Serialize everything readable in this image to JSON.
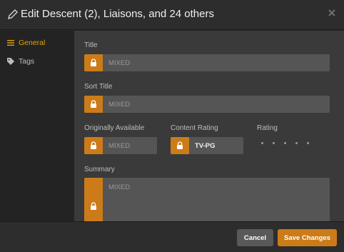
{
  "header": {
    "title": "Edit Descent (2), Liaisons, and 24 others"
  },
  "sidebar": {
    "items": [
      {
        "label": "General",
        "icon": "list-icon",
        "active": true
      },
      {
        "label": "Tags",
        "icon": "tag-icon",
        "active": false
      }
    ]
  },
  "form": {
    "title": {
      "label": "Title",
      "placeholder": "MIXED"
    },
    "sort_title": {
      "label": "Sort Title",
      "placeholder": "MIXED"
    },
    "originally_available": {
      "label": "Originally Available",
      "placeholder": "MIXED"
    },
    "content_rating": {
      "label": "Content Rating",
      "value": "TV-PG"
    },
    "rating": {
      "label": "Rating",
      "stars": 0,
      "max": 5
    },
    "summary": {
      "label": "Summary",
      "placeholder": "MIXED"
    }
  },
  "footer": {
    "cancel_label": "Cancel",
    "save_label": "Save Changes"
  },
  "colors": {
    "accent": "#cc7b19",
    "active_nav": "#e5a00d",
    "background": "#282828"
  }
}
